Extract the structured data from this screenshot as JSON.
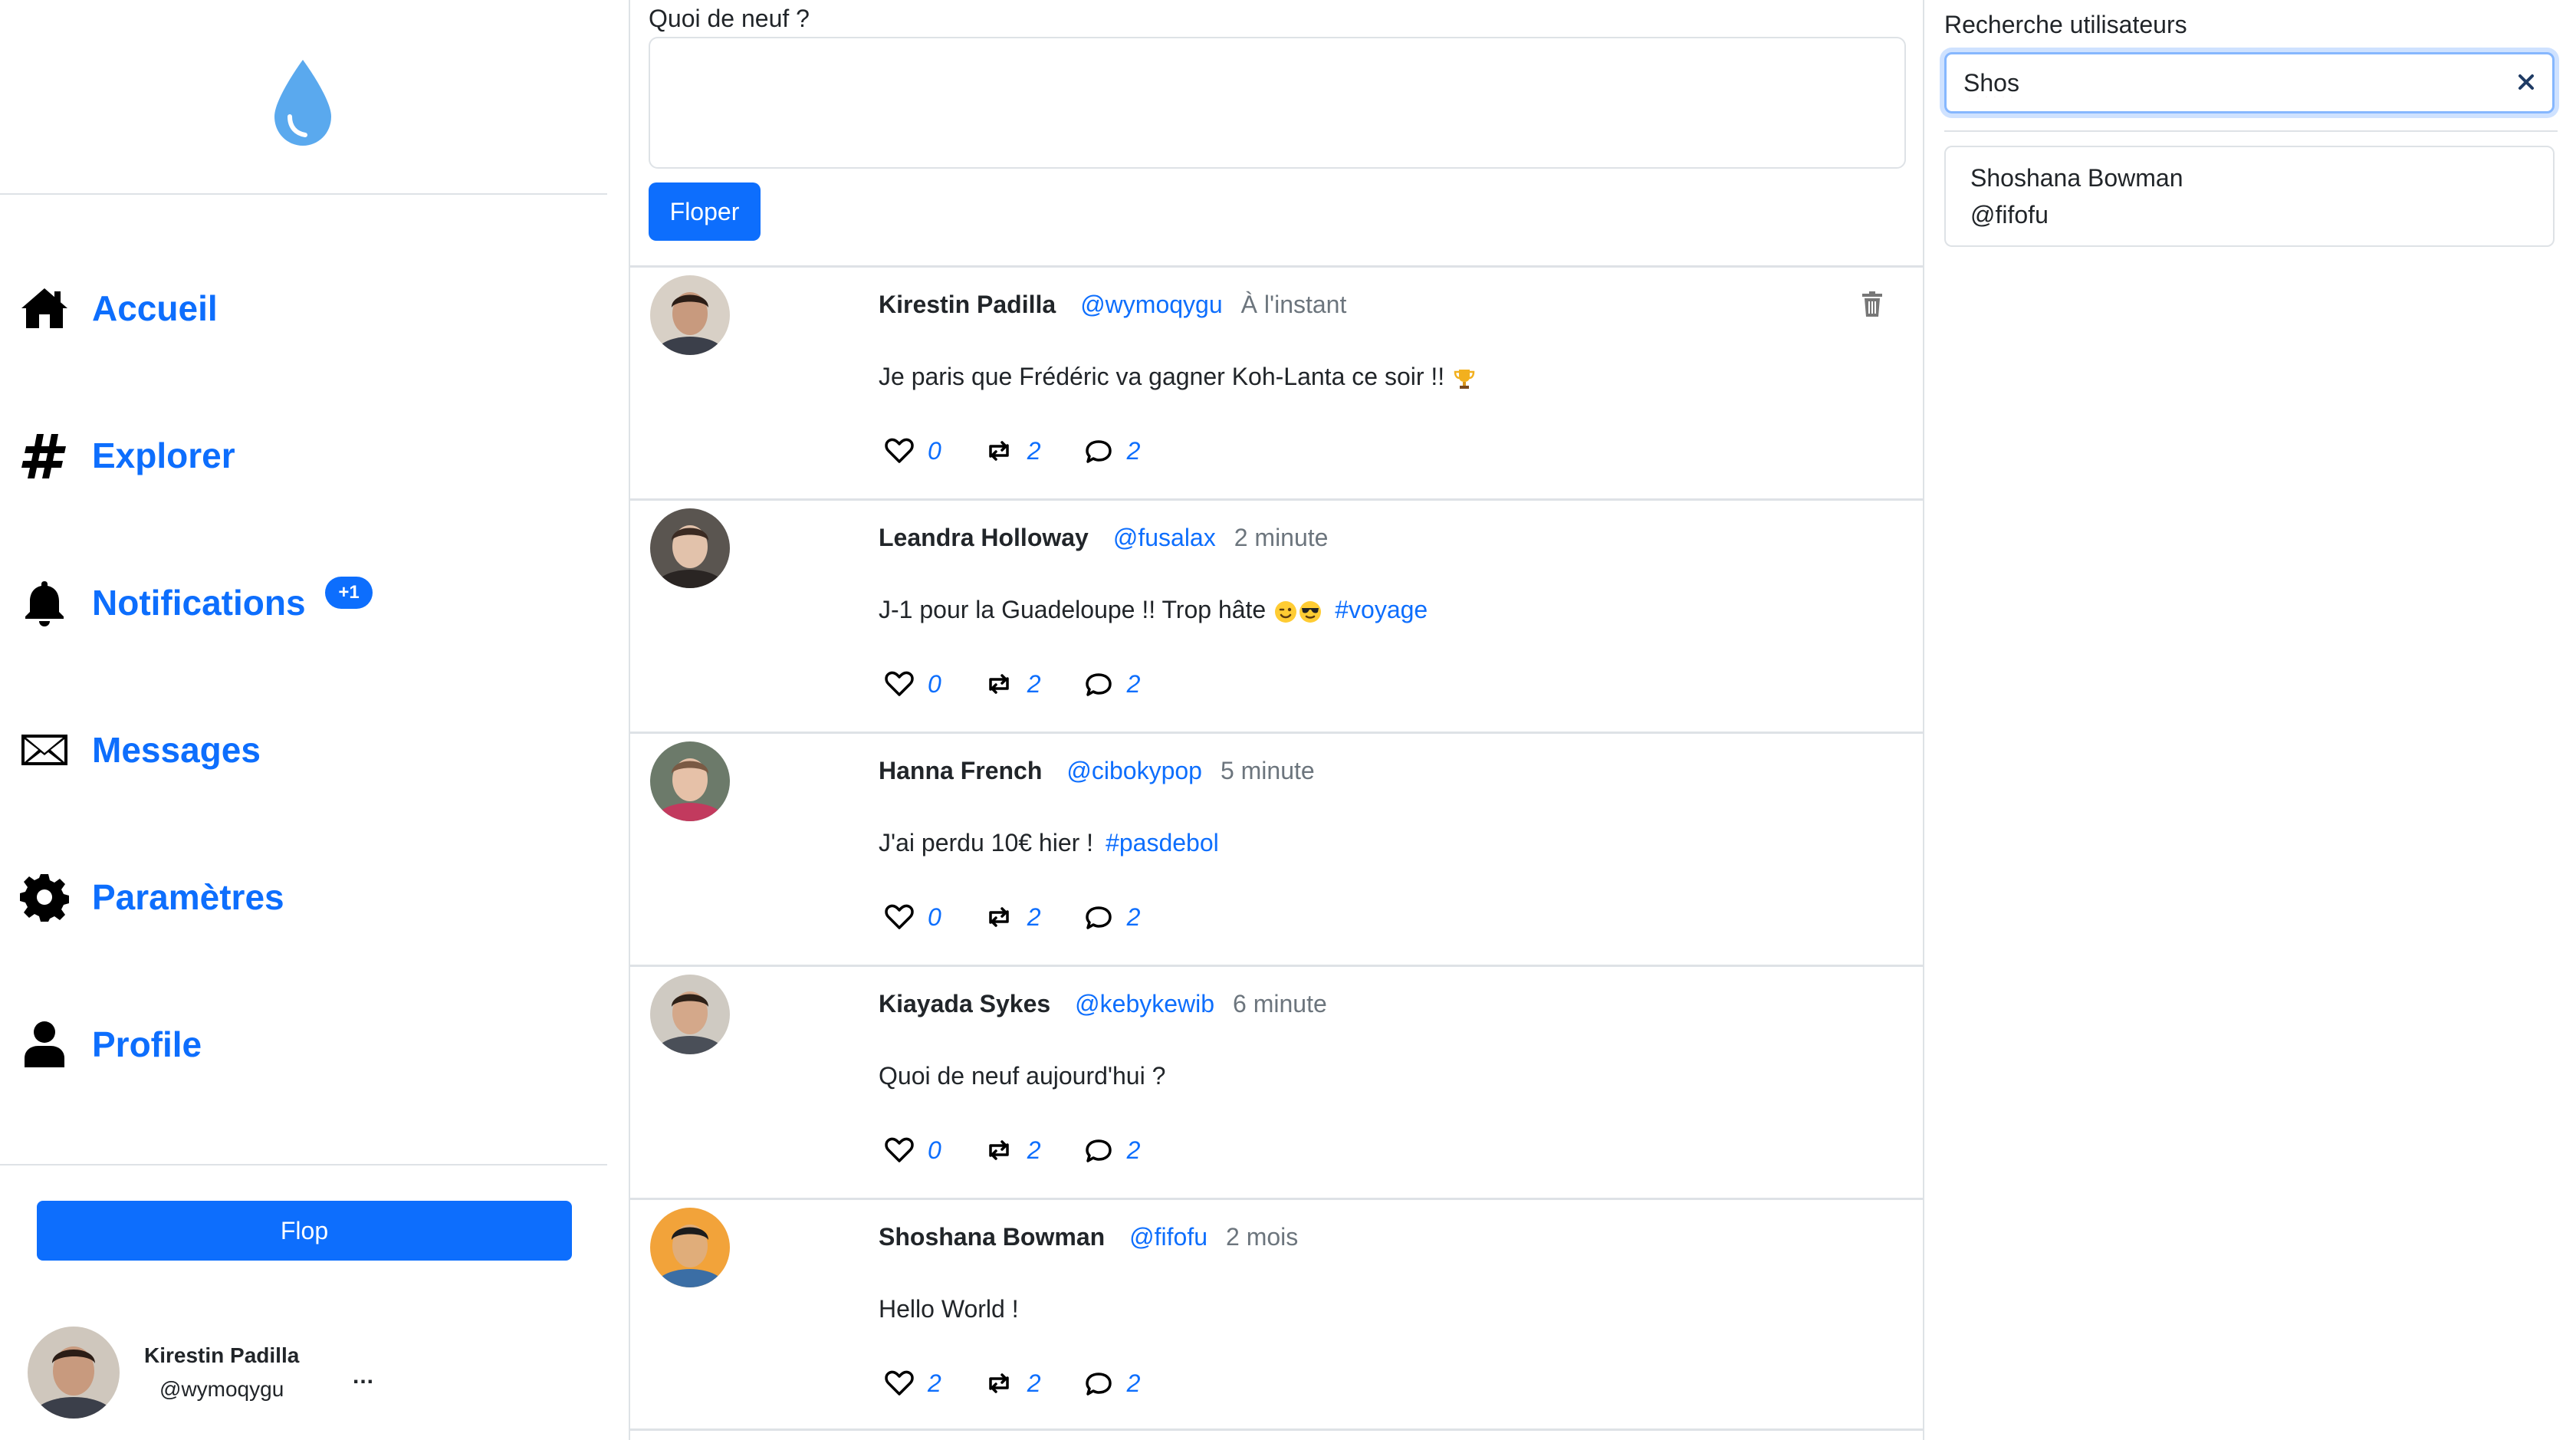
{
  "colors": {
    "accent": "#0d6efd",
    "muted": "#6c757d",
    "border": "#dee2e6",
    "drop": "#5aa9ee"
  },
  "sidebar": {
    "logo_icon": "water-drop-icon",
    "nav": [
      {
        "label": "Accueil",
        "icon": "home-icon"
      },
      {
        "label": "Explorer",
        "icon": "hashtag-icon"
      },
      {
        "label": "Notifications",
        "icon": "bell-icon",
        "badge": "+1"
      },
      {
        "label": "Messages",
        "icon": "envelope-icon"
      },
      {
        "label": "Paramètres",
        "icon": "gear-icon"
      },
      {
        "label": "Profile",
        "icon": "person-icon"
      }
    ],
    "flop_label": "Flop",
    "user": {
      "name": "Kirestin Padilla",
      "handle": "@wymoqygu",
      "menu": "..."
    }
  },
  "compose": {
    "label": "Quoi de neuf ?",
    "value": "",
    "button": "Floper"
  },
  "feed": {
    "posts": [
      {
        "author": "Kirestin Padilla",
        "handle": "@wymoqygu",
        "time": "À l'instant",
        "text": "Je paris que Frédéric va gagner Koh-Lanta ce soir !!",
        "emoji": [
          "trophy"
        ],
        "hashtag": "",
        "likes": "0",
        "reposts": "2",
        "comments": "2",
        "deletable": true
      },
      {
        "author": "Leandra Holloway",
        "handle": "@fusalax",
        "time": "2 minute",
        "text": "J-1 pour la Guadeloupe !! Trop hâte",
        "emoji": [
          "winking-face",
          "sunglasses-face"
        ],
        "hashtag": "#voyage",
        "likes": "0",
        "reposts": "2",
        "comments": "2",
        "deletable": false
      },
      {
        "author": "Hanna French",
        "handle": "@cibokypop",
        "time": "5 minute",
        "text": "J'ai perdu 10€ hier !",
        "emoji": [],
        "hashtag": "#pasdebol",
        "likes": "0",
        "reposts": "2",
        "comments": "2",
        "deletable": false
      },
      {
        "author": "Kiayada Sykes",
        "handle": "@kebykewib",
        "time": "6 minute",
        "text": "Quoi de neuf aujourd'hui ?",
        "emoji": [],
        "hashtag": "",
        "likes": "0",
        "reposts": "2",
        "comments": "2",
        "deletable": false
      },
      {
        "author": "Shoshana Bowman",
        "handle": "@fifofu",
        "time": "2 mois",
        "text": "Hello World !",
        "emoji": [],
        "hashtag": "",
        "likes": "2",
        "reposts": "2",
        "comments": "2",
        "deletable": false
      }
    ]
  },
  "search": {
    "title": "Recherche utilisateurs",
    "value": "Shos",
    "clear_icon": "close-icon",
    "results": [
      {
        "name": "Shoshana Bowman",
        "handle": "@fifofu"
      }
    ]
  }
}
